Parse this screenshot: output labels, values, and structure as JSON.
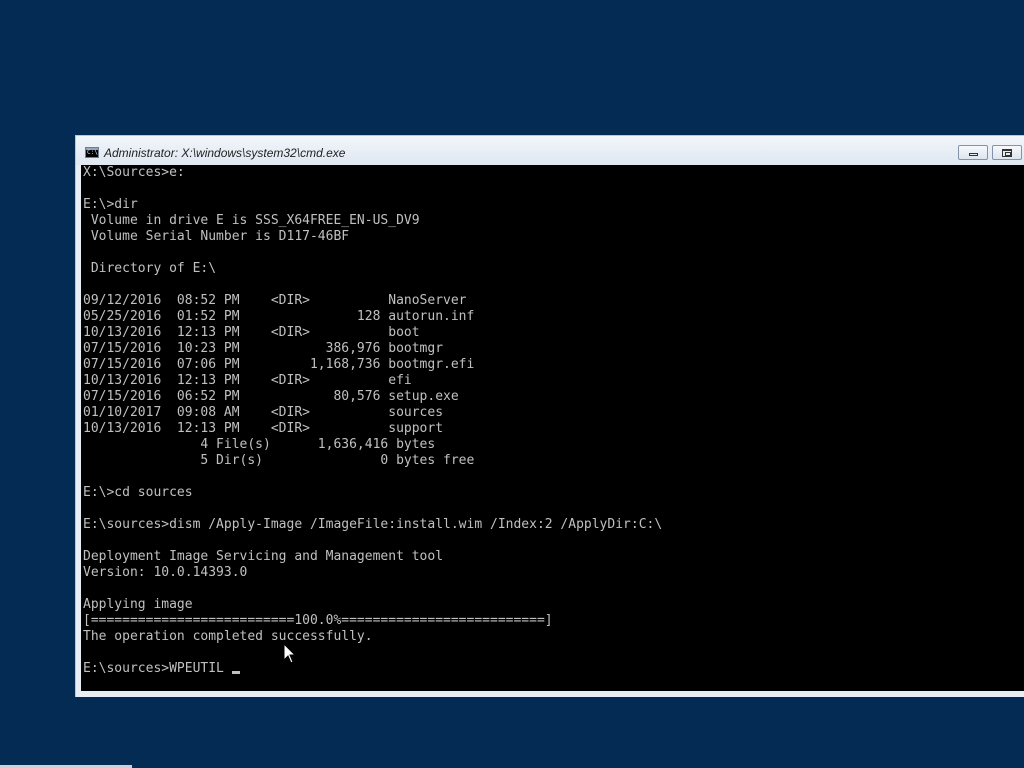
{
  "window": {
    "title": "Administrator: X:\\windows\\system32\\cmd.exe"
  },
  "console": {
    "lines": [
      "X:\\Sources>e:",
      "",
      "E:\\>dir",
      " Volume in drive E is SSS_X64FREE_EN-US_DV9",
      " Volume Serial Number is D117-46BF",
      "",
      " Directory of E:\\",
      "",
      "09/12/2016  08:52 PM    <DIR>          NanoServer",
      "05/25/2016  01:52 PM               128 autorun.inf",
      "10/13/2016  12:13 PM    <DIR>          boot",
      "07/15/2016  10:23 PM           386,976 bootmgr",
      "07/15/2016  07:06 PM         1,168,736 bootmgr.efi",
      "10/13/2016  12:13 PM    <DIR>          efi",
      "07/15/2016  06:52 PM            80,576 setup.exe",
      "01/10/2017  09:08 AM    <DIR>          sources",
      "10/13/2016  12:13 PM    <DIR>          support",
      "               4 File(s)      1,636,416 bytes",
      "               5 Dir(s)               0 bytes free",
      "",
      "E:\\>cd sources",
      "",
      "E:\\sources>dism /Apply-Image /ImageFile:install.wim /Index:2 /ApplyDir:C:\\",
      "",
      "Deployment Image Servicing and Management tool",
      "Version: 10.0.14393.0",
      "",
      "Applying image",
      "[==========================100.0%==========================]",
      "The operation completed successfully.",
      ""
    ],
    "prompt": "E:\\sources>",
    "current_input": "WPEUTIL "
  },
  "icons": {
    "window_icon": "cmd-icon",
    "minimize": "minimize-icon",
    "maximize": "maximize-icon",
    "pointer": "mouse-pointer-icon"
  }
}
